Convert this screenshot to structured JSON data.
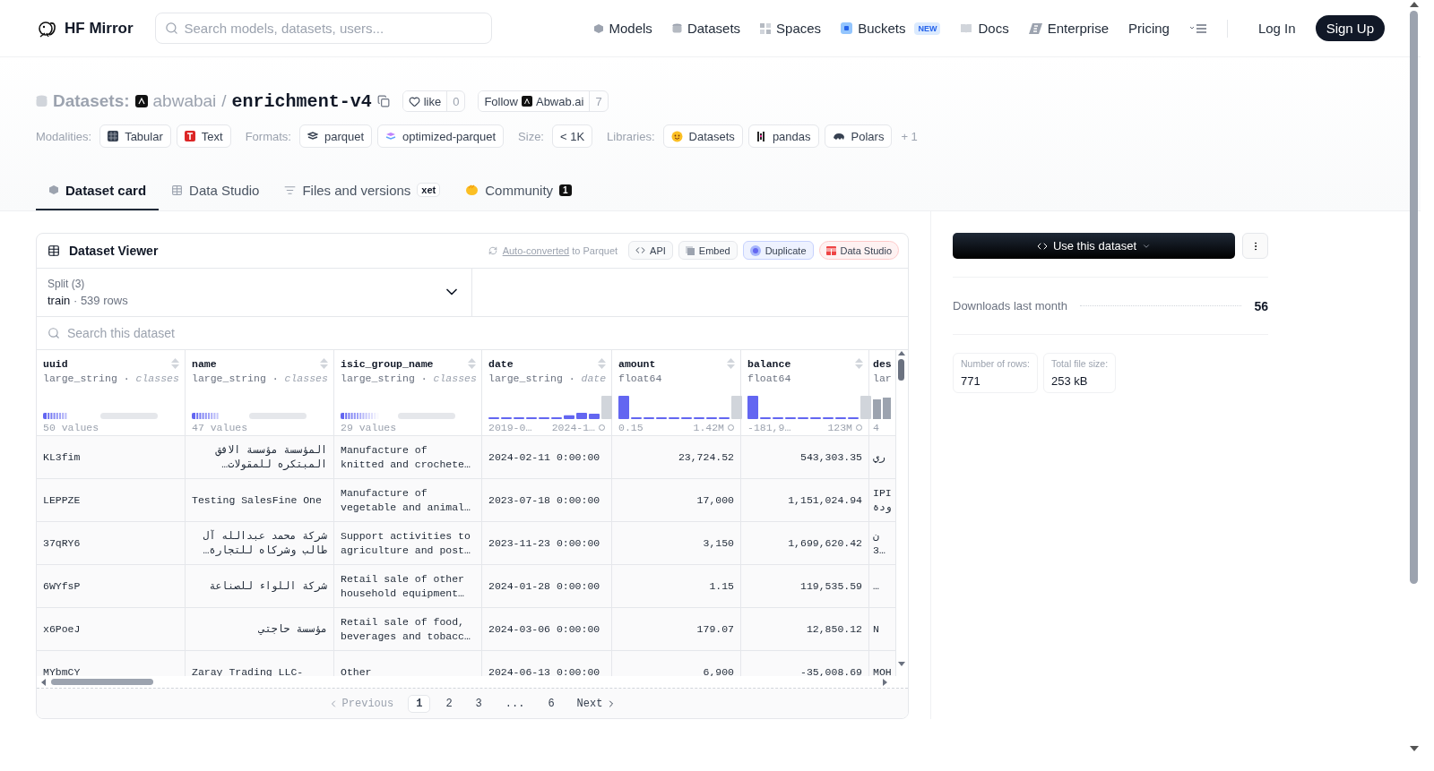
{
  "nav": {
    "brand": "HF Mirror",
    "search_placeholder": "Search models, datasets, users...",
    "links": [
      {
        "label": "Models"
      },
      {
        "label": "Datasets"
      },
      {
        "label": "Spaces"
      },
      {
        "label": "Buckets",
        "badge": "NEW"
      },
      {
        "label": "Docs"
      },
      {
        "label": "Enterprise"
      },
      {
        "label": "Pricing"
      }
    ],
    "login": "Log In",
    "signup": "Sign Up"
  },
  "header": {
    "prefix": "Datasets:",
    "owner": "abwabai",
    "separator": "/",
    "name": "enrichment-v4",
    "like": {
      "label": "like",
      "count": "0"
    },
    "follow": {
      "label": "Follow",
      "org": "Abwab.ai",
      "count": "7"
    },
    "tag_groups": [
      {
        "label": "Modalities:",
        "tags": [
          "Tabular",
          "Text"
        ]
      },
      {
        "label": "Formats:",
        "tags": [
          "parquet",
          "optimized-parquet"
        ]
      },
      {
        "label": "Size:",
        "tags": [
          "< 1K"
        ]
      },
      {
        "label": "Libraries:",
        "tags": [
          "Datasets",
          "pandas",
          "Polars"
        ]
      }
    ],
    "more_tags": "+ 1"
  },
  "tabs": [
    {
      "label": "Dataset card",
      "selected": true
    },
    {
      "label": "Data Studio",
      "selected": false
    },
    {
      "label": "Files and versions",
      "badge": "xet",
      "selected": false
    },
    {
      "label": "Community",
      "count": "1",
      "selected": false
    }
  ],
  "viewer": {
    "title": "Dataset Viewer",
    "note_link": "Auto-converted",
    "note_rest": "to Parquet",
    "actions": [
      {
        "label": "API",
        "kind": "plain"
      },
      {
        "label": "Embed",
        "kind": "plain"
      },
      {
        "label": "Duplicate",
        "kind": "duplicate"
      },
      {
        "label": "Data Studio",
        "kind": "studio"
      }
    ],
    "split": {
      "label": "Split (3)",
      "name": "train",
      "separator": "·",
      "rows": "539 rows"
    },
    "search_placeholder": "Search this dataset",
    "columns": [
      {
        "name": "uuid",
        "dtype": "large_string",
        "separator": "·",
        "extra": "classes",
        "summary": {
          "kind": "classes",
          "label": "50 values"
        }
      },
      {
        "name": "name",
        "dtype": "large_string",
        "separator": "·",
        "extra": "classes",
        "summary": {
          "kind": "classes",
          "label": "47 values"
        }
      },
      {
        "name": "isic_group_name",
        "dtype": "large_string",
        "separator": "·",
        "extra": "classes",
        "summary": {
          "kind": "classes",
          "label": "29 values"
        }
      },
      {
        "name": "date",
        "dtype": "large_string",
        "separator": "·",
        "extra": "date",
        "summary": {
          "kind": "histogram",
          "min": "2019-0…",
          "max": "2024-1…"
        }
      },
      {
        "name": "amount",
        "dtype": "float64",
        "summary": {
          "kind": "histogram",
          "min": "0.15",
          "max": "1.42M"
        }
      },
      {
        "name": "balance",
        "dtype": "float64",
        "summary": {
          "kind": "histogram",
          "min": "-181,9…",
          "max": "123M"
        }
      },
      {
        "name": "des",
        "dtype": "lar",
        "summary": {
          "kind": "partial",
          "min": "4"
        }
      }
    ],
    "rows": [
      [
        "KL3fim",
        "المؤسسة مؤسسة الافق المبتكره للمقولات…",
        "Manufacture of knitted and crochete…",
        "2024-02-11 0:00:00",
        "23,724.52",
        "543,303.35",
        "ري"
      ],
      [
        "LEPPZE",
        "Testing SalesFine One",
        "Manufacture of vegetable and animal…",
        "2023-07-18 0:00:00",
        "17,000",
        "1,151,024.94",
        "IPI ودة"
      ],
      [
        "37qRY6",
        "شركة محمد عبدالله آل طالب وشركاه للتجارة…",
        "Support activities to agriculture and post…",
        "2023-11-23 0:00:00",
        "3,150",
        "1,699,620.42",
        "ن 3…"
      ],
      [
        "6WYfsP",
        "شركة اللواء للصناعة",
        "Retail sale of other household equipment…",
        "2024-01-28 0:00:00",
        "1.15",
        "119,535.59",
        "…"
      ],
      [
        "x6PoeJ",
        "مؤسسة حاجتي",
        "Retail sale of food, beverages and tobacc…",
        "2024-03-06 0:00:00",
        "179.07",
        "12,850.12",
        "N"
      ],
      [
        "MYbmCY",
        "Zaray Trading LLC-",
        "Other",
        "2024-06-13 0:00:00",
        "6,900",
        "-35,008.69",
        "MOH"
      ]
    ],
    "pagination": {
      "previous": "Previous",
      "pages": [
        {
          "label": "1",
          "selected": true
        },
        {
          "label": "2",
          "selected": false
        },
        {
          "label": "3",
          "selected": false
        },
        {
          "label": "...",
          "selected": false
        },
        {
          "label": "6",
          "selected": false
        }
      ],
      "next": "Next"
    }
  },
  "sidebar": {
    "use_button": "Use this dataset",
    "downloads_label": "Downloads last month",
    "downloads": "56",
    "stats": [
      {
        "label": "Number of rows:",
        "value": "771"
      },
      {
        "label": "Total file size:",
        "value": "253 kB"
      }
    ]
  }
}
